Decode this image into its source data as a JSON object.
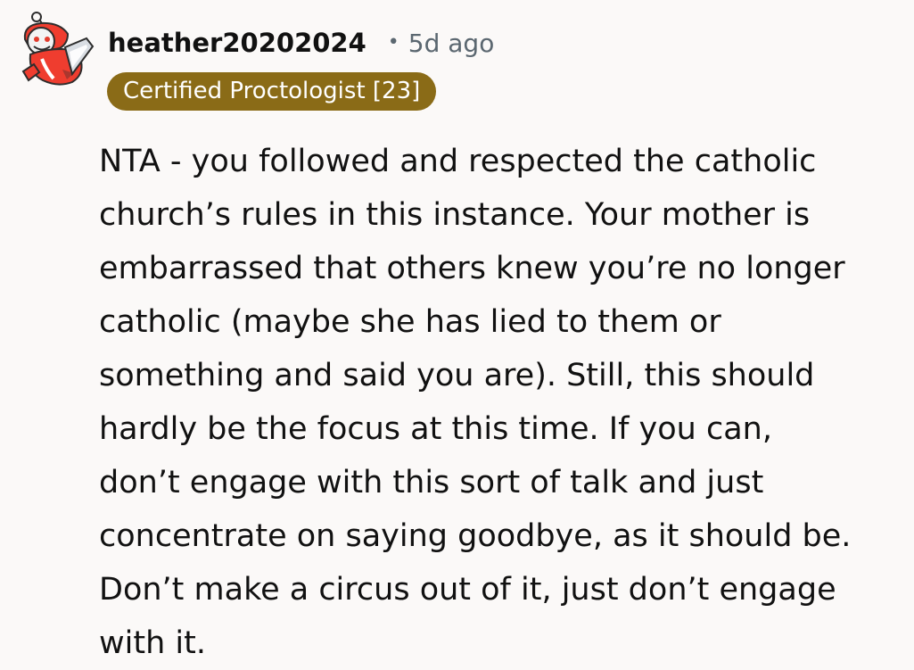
{
  "comment": {
    "author": "heather20202024",
    "separator": "•",
    "timestamp": "5d ago",
    "flair": "Certified Proctologist [23]",
    "body": "NTA - you followed and respected the catholic\nchurch’s rules in this instance. Your mother is\nembarrassed that others knew you’re no longer\ncatholic (maybe she has lied to them or\nsomething and said you are). Still, this should\nhardly be the focus at this time. If you can,\ndon’t engage with this sort of talk and just\nconcentrate on saying goodbye, as it should be.\nDon’t make a circus out of it, just don’t engage\nwith it."
  },
  "avatar": {
    "icon": "snoo-avatar-icon"
  },
  "colors": {
    "background": "#fbf9f8",
    "flair_background": "#8a6b17",
    "flair_text": "#ffffff",
    "meta_text": "#5b6770",
    "body_text": "#111111"
  }
}
